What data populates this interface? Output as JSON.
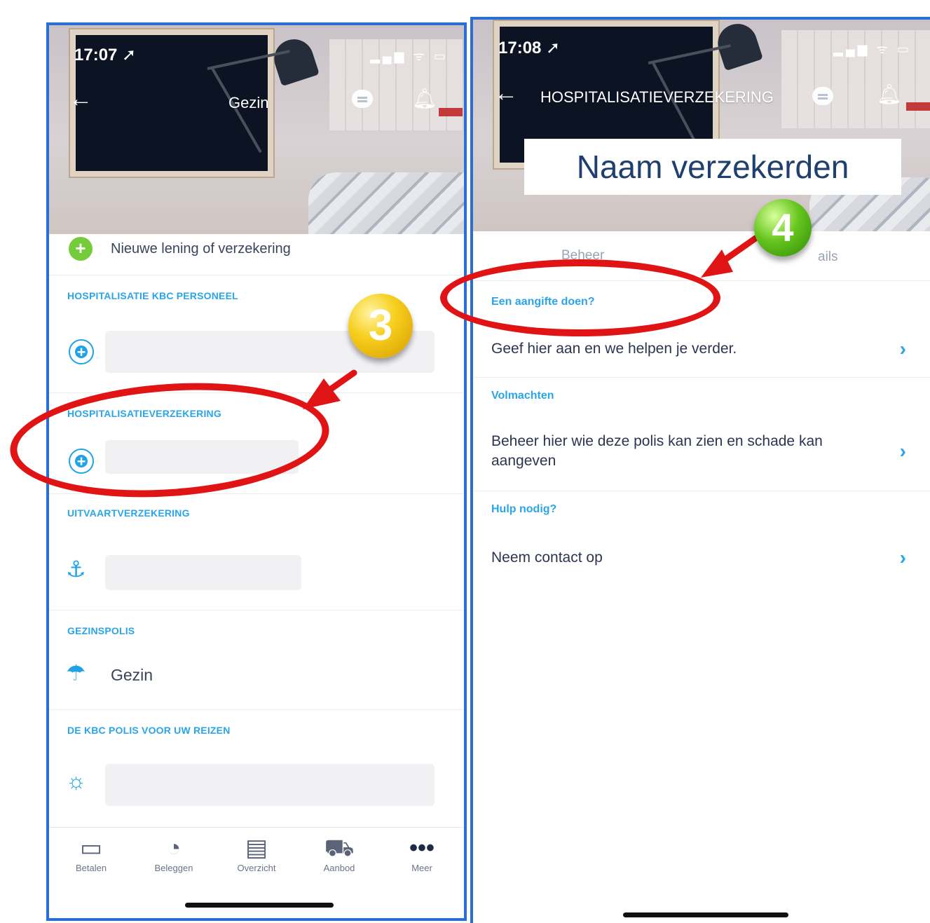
{
  "left_screen": {
    "status_time": "17:07 ➚",
    "status_icons": "▂▄▆ ᯤ ▭",
    "title": "Gezin",
    "new_item": "Nieuwe lening of verzekering",
    "sections": {
      "hosp_kbc": "HOSPITALISATIE KBC PERSONEEL",
      "hosp": "HOSPITALISATIEVERZEKERING",
      "uitvaart": "UITVAARTVERZEKERING",
      "gezinspolis": "GEZINSPOLIS",
      "reizen": "DE KBC POLIS VOOR UW REIZEN"
    },
    "gezin_item": "Gezin",
    "tabbar": [
      {
        "label": "Betalen",
        "icon": "wallet-icon",
        "glyph": "▭"
      },
      {
        "label": "Beleggen",
        "icon": "piggy-bank-icon",
        "glyph": "◔"
      },
      {
        "label": "Overzicht",
        "icon": "document-icon",
        "glyph": "▤"
      },
      {
        "label": "Aanbod",
        "icon": "cart-icon",
        "glyph": "⛟"
      },
      {
        "label": "Meer",
        "icon": "more-icon",
        "glyph": "•••"
      }
    ]
  },
  "right_screen": {
    "status_time": "17:08 ➚",
    "status_icons": "▂▄▆ ᯤ ▭",
    "title": "HOSPITALISATIEVERZEKERING",
    "tab_beheer": "Beheer",
    "tab_details": "ails",
    "sections": [
      {
        "label": "Een aangifte doen?",
        "text": "Geef hier aan en we helpen je verder."
      },
      {
        "label": "Volmachten",
        "text": "Beheer hier wie deze polis kan zien en schade kan aangeven"
      },
      {
        "label": "Hulp nodig?",
        "text": "Neem contact op"
      }
    ]
  },
  "annotations": {
    "badge_3": "3",
    "badge_4": "4",
    "callout": "Naam verzekerden",
    "color": "#e01414"
  },
  "colors": {
    "accent": "#1ea3e8",
    "frame": "#2a6fd6"
  }
}
